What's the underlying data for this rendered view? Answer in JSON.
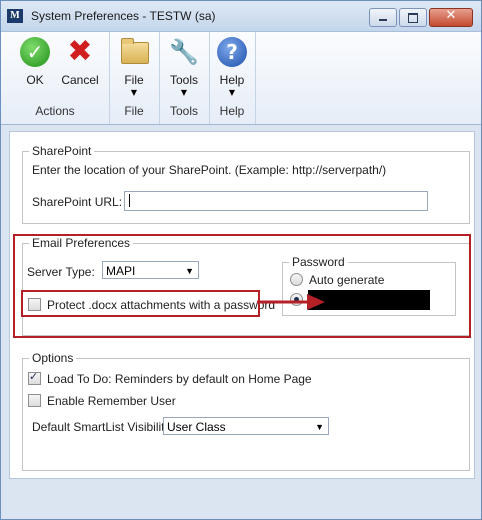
{
  "window": {
    "title": "System Preferences  -  TESTW (sa)",
    "app_icon_glyph": "M",
    "close_glyph": "✕"
  },
  "ribbon": {
    "groups": [
      {
        "label": "Actions",
        "buttons": [
          {
            "label": "OK",
            "icon": "ok-check-icon"
          },
          {
            "label": "Cancel",
            "icon": "cancel-x-icon"
          }
        ]
      },
      {
        "label": "File",
        "buttons": [
          {
            "label": "File",
            "icon": "folder-icon"
          }
        ]
      },
      {
        "label": "Tools",
        "buttons": [
          {
            "label": "Tools",
            "icon": "tools-icon"
          }
        ]
      },
      {
        "label": "Help",
        "buttons": [
          {
            "label": "Help",
            "icon": "help-icon"
          }
        ]
      }
    ],
    "dropdown_arrow": "▼",
    "ok_glyph": "✓",
    "cancel_glyph": "✖",
    "tools_glyph": "🔧",
    "help_glyph": "?"
  },
  "sharepoint": {
    "legend": "SharePoint",
    "description": "Enter the location of your SharePoint. (Example: http://serverpath/)",
    "url_label": "SharePoint URL:",
    "url_value": ""
  },
  "email": {
    "legend": "Email Preferences",
    "server_type_label": "Server Type:",
    "server_type_value": "MAPI",
    "protect_label": "Protect .docx attachments with a password",
    "protect_checked": false,
    "password_legend": "Password",
    "auto_generate_label": "Auto generate",
    "auto_generate_selected": false,
    "manual_selected": true
  },
  "options": {
    "legend": "Options",
    "load_todo_label": "Load To Do: Reminders by default on Home Page",
    "load_todo_checked": true,
    "enable_remember_label": "Enable Remember User",
    "enable_remember_checked": false,
    "smartlist_label": "Default SmartList Visibility:",
    "smartlist_value": "User Class"
  },
  "colors": {
    "highlight": "#b42025",
    "window_bg": "#dbe5f1"
  }
}
